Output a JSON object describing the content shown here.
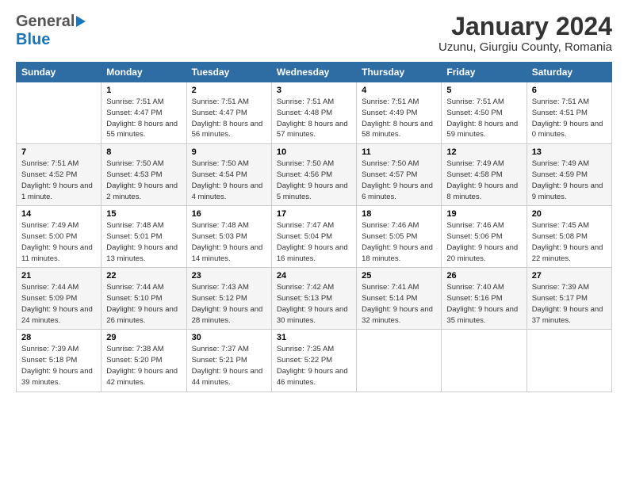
{
  "header": {
    "logo_line1": "General",
    "logo_line2": "Blue",
    "title": "January 2024",
    "subtitle": "Uzunu, Giurgiu County, Romania"
  },
  "days_of_week": [
    "Sunday",
    "Monday",
    "Tuesday",
    "Wednesday",
    "Thursday",
    "Friday",
    "Saturday"
  ],
  "weeks": [
    [
      {
        "num": "",
        "sunrise": "",
        "sunset": "",
        "daylight": ""
      },
      {
        "num": "1",
        "sunrise": "Sunrise: 7:51 AM",
        "sunset": "Sunset: 4:47 PM",
        "daylight": "Daylight: 8 hours and 55 minutes."
      },
      {
        "num": "2",
        "sunrise": "Sunrise: 7:51 AM",
        "sunset": "Sunset: 4:47 PM",
        "daylight": "Daylight: 8 hours and 56 minutes."
      },
      {
        "num": "3",
        "sunrise": "Sunrise: 7:51 AM",
        "sunset": "Sunset: 4:48 PM",
        "daylight": "Daylight: 8 hours and 57 minutes."
      },
      {
        "num": "4",
        "sunrise": "Sunrise: 7:51 AM",
        "sunset": "Sunset: 4:49 PM",
        "daylight": "Daylight: 8 hours and 58 minutes."
      },
      {
        "num": "5",
        "sunrise": "Sunrise: 7:51 AM",
        "sunset": "Sunset: 4:50 PM",
        "daylight": "Daylight: 8 hours and 59 minutes."
      },
      {
        "num": "6",
        "sunrise": "Sunrise: 7:51 AM",
        "sunset": "Sunset: 4:51 PM",
        "daylight": "Daylight: 9 hours and 0 minutes."
      }
    ],
    [
      {
        "num": "7",
        "sunrise": "Sunrise: 7:51 AM",
        "sunset": "Sunset: 4:52 PM",
        "daylight": "Daylight: 9 hours and 1 minute."
      },
      {
        "num": "8",
        "sunrise": "Sunrise: 7:50 AM",
        "sunset": "Sunset: 4:53 PM",
        "daylight": "Daylight: 9 hours and 2 minutes."
      },
      {
        "num": "9",
        "sunrise": "Sunrise: 7:50 AM",
        "sunset": "Sunset: 4:54 PM",
        "daylight": "Daylight: 9 hours and 4 minutes."
      },
      {
        "num": "10",
        "sunrise": "Sunrise: 7:50 AM",
        "sunset": "Sunset: 4:56 PM",
        "daylight": "Daylight: 9 hours and 5 minutes."
      },
      {
        "num": "11",
        "sunrise": "Sunrise: 7:50 AM",
        "sunset": "Sunset: 4:57 PM",
        "daylight": "Daylight: 9 hours and 6 minutes."
      },
      {
        "num": "12",
        "sunrise": "Sunrise: 7:49 AM",
        "sunset": "Sunset: 4:58 PM",
        "daylight": "Daylight: 9 hours and 8 minutes."
      },
      {
        "num": "13",
        "sunrise": "Sunrise: 7:49 AM",
        "sunset": "Sunset: 4:59 PM",
        "daylight": "Daylight: 9 hours and 9 minutes."
      }
    ],
    [
      {
        "num": "14",
        "sunrise": "Sunrise: 7:49 AM",
        "sunset": "Sunset: 5:00 PM",
        "daylight": "Daylight: 9 hours and 11 minutes."
      },
      {
        "num": "15",
        "sunrise": "Sunrise: 7:48 AM",
        "sunset": "Sunset: 5:01 PM",
        "daylight": "Daylight: 9 hours and 13 minutes."
      },
      {
        "num": "16",
        "sunrise": "Sunrise: 7:48 AM",
        "sunset": "Sunset: 5:03 PM",
        "daylight": "Daylight: 9 hours and 14 minutes."
      },
      {
        "num": "17",
        "sunrise": "Sunrise: 7:47 AM",
        "sunset": "Sunset: 5:04 PM",
        "daylight": "Daylight: 9 hours and 16 minutes."
      },
      {
        "num": "18",
        "sunrise": "Sunrise: 7:46 AM",
        "sunset": "Sunset: 5:05 PM",
        "daylight": "Daylight: 9 hours and 18 minutes."
      },
      {
        "num": "19",
        "sunrise": "Sunrise: 7:46 AM",
        "sunset": "Sunset: 5:06 PM",
        "daylight": "Daylight: 9 hours and 20 minutes."
      },
      {
        "num": "20",
        "sunrise": "Sunrise: 7:45 AM",
        "sunset": "Sunset: 5:08 PM",
        "daylight": "Daylight: 9 hours and 22 minutes."
      }
    ],
    [
      {
        "num": "21",
        "sunrise": "Sunrise: 7:44 AM",
        "sunset": "Sunset: 5:09 PM",
        "daylight": "Daylight: 9 hours and 24 minutes."
      },
      {
        "num": "22",
        "sunrise": "Sunrise: 7:44 AM",
        "sunset": "Sunset: 5:10 PM",
        "daylight": "Daylight: 9 hours and 26 minutes."
      },
      {
        "num": "23",
        "sunrise": "Sunrise: 7:43 AM",
        "sunset": "Sunset: 5:12 PM",
        "daylight": "Daylight: 9 hours and 28 minutes."
      },
      {
        "num": "24",
        "sunrise": "Sunrise: 7:42 AM",
        "sunset": "Sunset: 5:13 PM",
        "daylight": "Daylight: 9 hours and 30 minutes."
      },
      {
        "num": "25",
        "sunrise": "Sunrise: 7:41 AM",
        "sunset": "Sunset: 5:14 PM",
        "daylight": "Daylight: 9 hours and 32 minutes."
      },
      {
        "num": "26",
        "sunrise": "Sunrise: 7:40 AM",
        "sunset": "Sunset: 5:16 PM",
        "daylight": "Daylight: 9 hours and 35 minutes."
      },
      {
        "num": "27",
        "sunrise": "Sunrise: 7:39 AM",
        "sunset": "Sunset: 5:17 PM",
        "daylight": "Daylight: 9 hours and 37 minutes."
      }
    ],
    [
      {
        "num": "28",
        "sunrise": "Sunrise: 7:39 AM",
        "sunset": "Sunset: 5:18 PM",
        "daylight": "Daylight: 9 hours and 39 minutes."
      },
      {
        "num": "29",
        "sunrise": "Sunrise: 7:38 AM",
        "sunset": "Sunset: 5:20 PM",
        "daylight": "Daylight: 9 hours and 42 minutes."
      },
      {
        "num": "30",
        "sunrise": "Sunrise: 7:37 AM",
        "sunset": "Sunset: 5:21 PM",
        "daylight": "Daylight: 9 hours and 44 minutes."
      },
      {
        "num": "31",
        "sunrise": "Sunrise: 7:35 AM",
        "sunset": "Sunset: 5:22 PM",
        "daylight": "Daylight: 9 hours and 46 minutes."
      },
      {
        "num": "",
        "sunrise": "",
        "sunset": "",
        "daylight": ""
      },
      {
        "num": "",
        "sunrise": "",
        "sunset": "",
        "daylight": ""
      },
      {
        "num": "",
        "sunrise": "",
        "sunset": "",
        "daylight": ""
      }
    ]
  ]
}
